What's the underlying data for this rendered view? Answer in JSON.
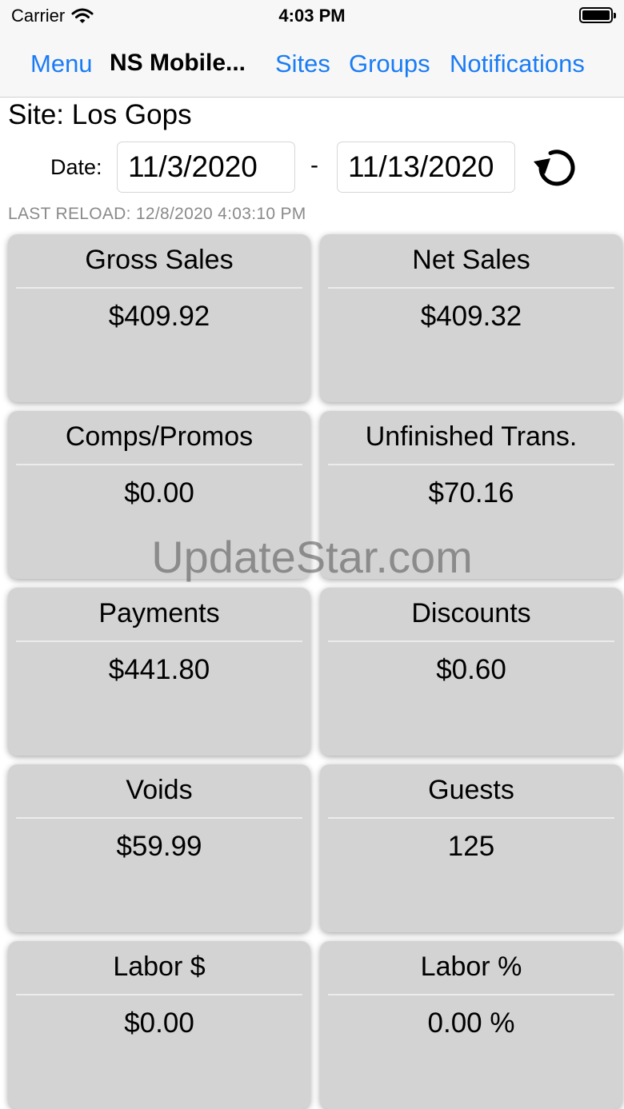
{
  "status_bar": {
    "carrier": "Carrier",
    "time": "4:03 PM"
  },
  "nav": {
    "menu": "Menu",
    "title": "NS Mobile...",
    "sites": "Sites",
    "groups": "Groups",
    "notifications": "Notifications"
  },
  "site": {
    "label": "Site: Los Gops"
  },
  "date": {
    "label": "Date:",
    "start": "11/3/2020",
    "separator": "-",
    "end": "11/13/2020"
  },
  "last_reload": "LAST RELOAD: 12/8/2020 4:03:10 PM",
  "cards": [
    {
      "title": "Gross Sales",
      "value": "$409.92"
    },
    {
      "title": "Net Sales",
      "value": "$409.32"
    },
    {
      "title": "Comps/Promos",
      "value": "$0.00"
    },
    {
      "title": "Unfinished Trans.",
      "value": "$70.16"
    },
    {
      "title": "Payments",
      "value": "$441.80"
    },
    {
      "title": "Discounts",
      "value": "$0.60"
    },
    {
      "title": "Voids",
      "value": "$59.99"
    },
    {
      "title": "Guests",
      "value": "125"
    },
    {
      "title": "Labor $",
      "value": "$0.00"
    },
    {
      "title": "Labor %",
      "value": "0.00 %"
    }
  ],
  "watermark": "UpdateStar.com",
  "colors": {
    "link": "#1a7cf5",
    "card_bg": "#d3d3d3",
    "muted": "#8a8a8a"
  }
}
